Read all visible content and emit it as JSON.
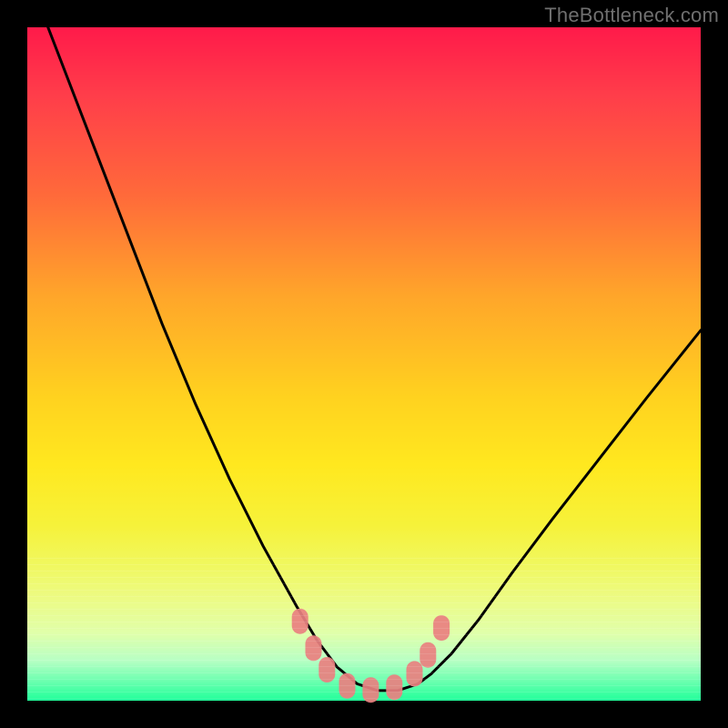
{
  "watermark": "TheBottleneck.com",
  "chart_data": {
    "type": "line",
    "title": "",
    "xlabel": "",
    "ylabel": "",
    "xlim": [
      0,
      1
    ],
    "ylim": [
      0,
      1
    ],
    "grid": false,
    "series": [
      {
        "name": "curve",
        "color": "#000000",
        "x": [
          0.0,
          0.05,
          0.1,
          0.15,
          0.2,
          0.25,
          0.3,
          0.35,
          0.4,
          0.43,
          0.46,
          0.49,
          0.52,
          0.55,
          0.58,
          0.6,
          0.63,
          0.67,
          0.72,
          0.78,
          0.85,
          0.92,
          1.0
        ],
        "values": [
          1.08,
          0.95,
          0.82,
          0.69,
          0.56,
          0.44,
          0.33,
          0.23,
          0.14,
          0.09,
          0.05,
          0.025,
          0.015,
          0.015,
          0.025,
          0.04,
          0.07,
          0.12,
          0.19,
          0.27,
          0.36,
          0.45,
          0.55
        ]
      },
      {
        "name": "markers",
        "color": "#e98080",
        "type": "scatter",
        "x": [
          0.405,
          0.425,
          0.445,
          0.475,
          0.51,
          0.545,
          0.575,
          0.595,
          0.615
        ],
        "values": [
          0.118,
          0.078,
          0.046,
          0.022,
          0.016,
          0.02,
          0.04,
          0.068,
          0.108
        ]
      }
    ]
  }
}
